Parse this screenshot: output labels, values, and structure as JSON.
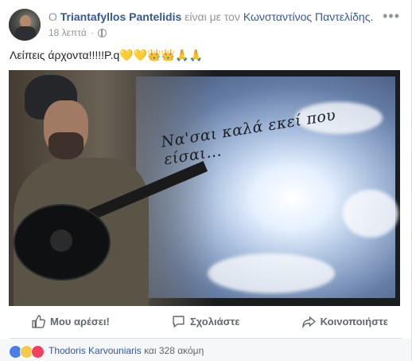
{
  "header": {
    "prefix": "Ο",
    "poster": "Triantafyllos Pantelidis",
    "with_text": "είναι με τον",
    "tagged": "Κωνσταντίνος Παντελίδης.",
    "time": "18 λεπτά",
    "more_label": "•••"
  },
  "post": {
    "text": "Λείπεις άρχοντα!!!!!Ρ.q",
    "hearts": "💛💛",
    "crowns": "👑👑",
    "hands": "🙏🙏",
    "image_caption": "Να'σαι καλά εκεί που είσαι..."
  },
  "actions": {
    "like": "Μου αρέσει!",
    "comment": "Σχολιάστε",
    "share": "Κοινοποιήστε"
  },
  "reactions": {
    "names": "Thodoris Karvouniaris",
    "and_more": "και 328 ακόμη"
  },
  "colors": {
    "link": "#365899",
    "muted": "#90949c",
    "like_blue": "#4a7ee4",
    "love_red": "#f0405d",
    "sad_yellow": "#f2c94c"
  }
}
